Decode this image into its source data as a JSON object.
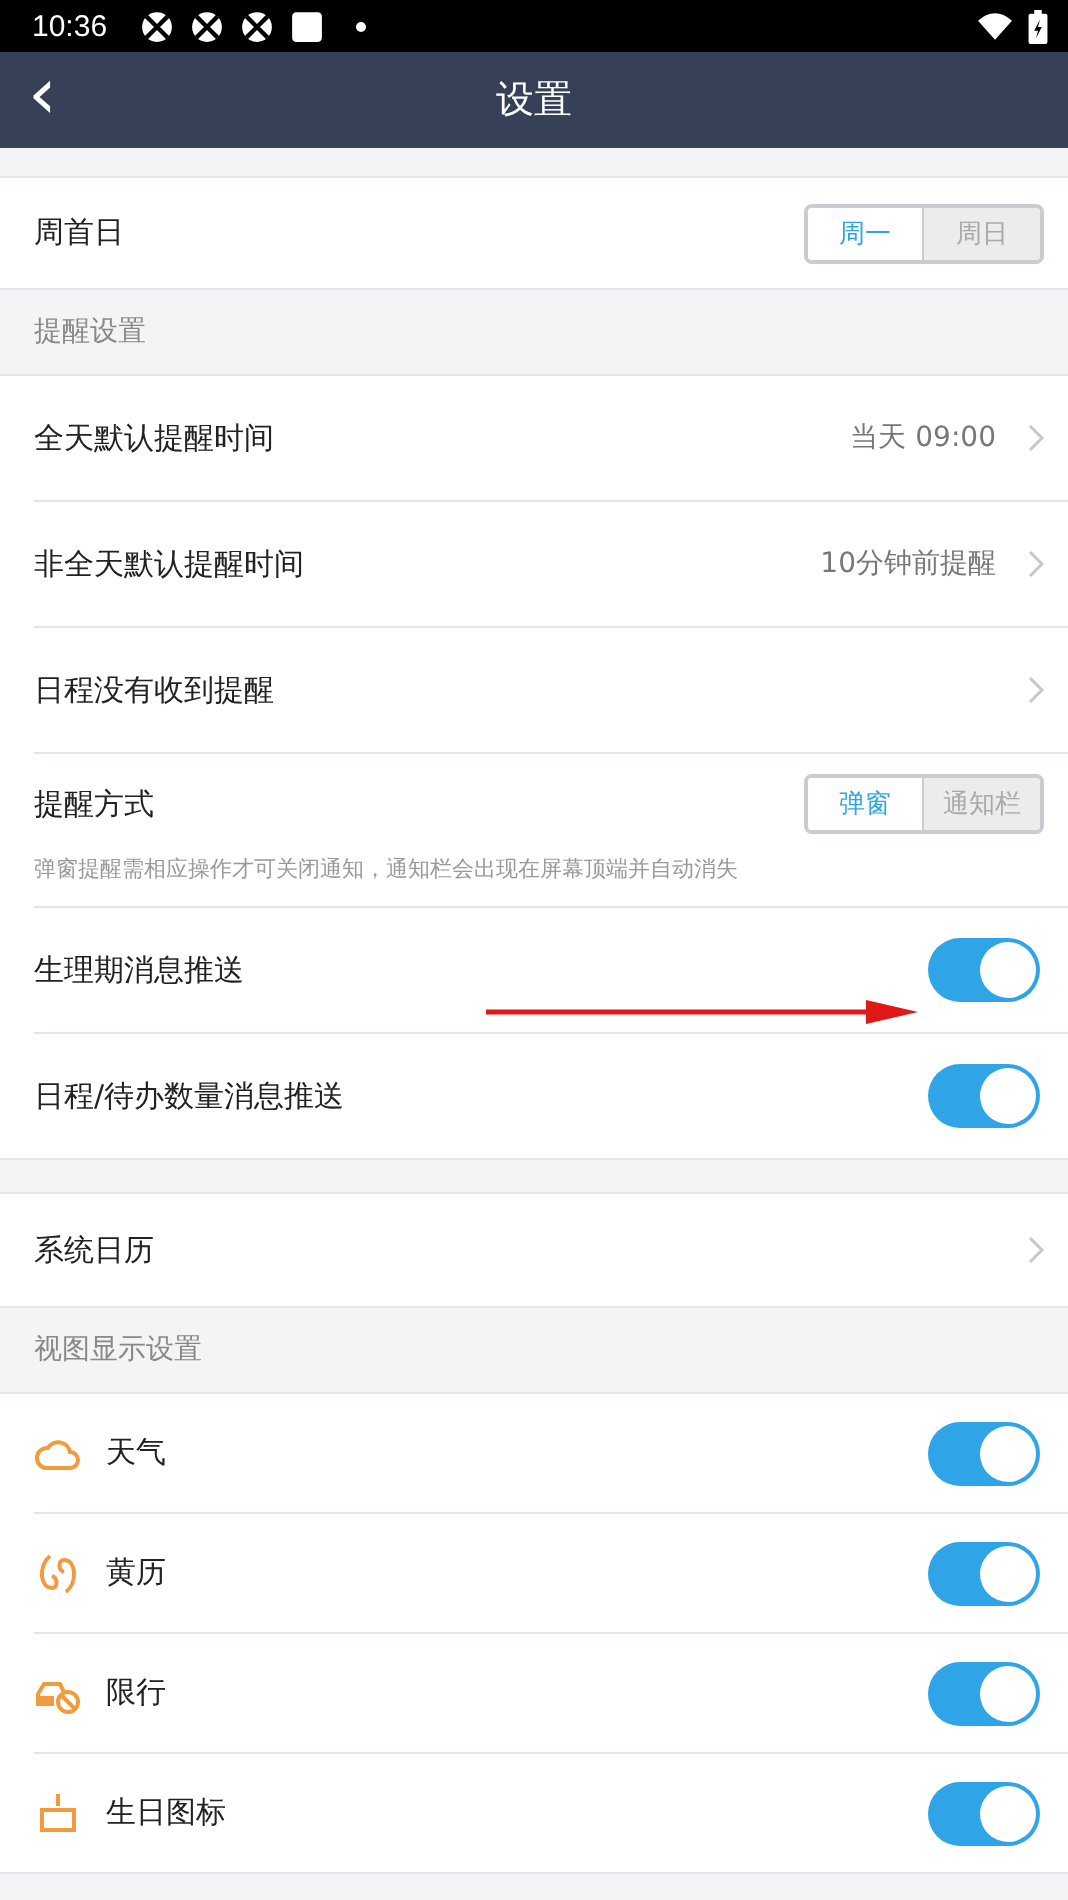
{
  "status_bar": {
    "time": "10:36"
  },
  "header": {
    "title": "设置",
    "back": "‹"
  },
  "groups": [
    {
      "rows": [
        {
          "kind": "segmented",
          "label": "周首日",
          "options": [
            {
              "label": "周一",
              "selected": true
            },
            {
              "label": "周日",
              "selected": false
            }
          ]
        }
      ]
    },
    {
      "title": "提醒设置",
      "rows": [
        {
          "kind": "link",
          "label": "全天默认提醒时间",
          "value": "当天 09:00"
        },
        {
          "kind": "link",
          "label": "非全天默认提醒时间",
          "value": "10分钟前提醒"
        },
        {
          "kind": "link",
          "label": "日程没有收到提醒"
        },
        {
          "kind": "segmented",
          "label": "提醒方式",
          "options": [
            {
              "label": "弹窗",
              "selected": true
            },
            {
              "label": "通知栏",
              "selected": false
            }
          ],
          "hint": "弹窗提醒需相应操作才可关闭通知，通知栏会出现在屏幕顶端并自动消失"
        },
        {
          "kind": "toggle",
          "label": "生理期消息推送",
          "on": true
        },
        {
          "kind": "toggle",
          "label": "日程/待办数量消息推送",
          "on": true
        }
      ]
    },
    {
      "rows": [
        {
          "kind": "link",
          "label": "系统日历"
        }
      ]
    },
    {
      "title": "视图显示设置",
      "rows": [
        {
          "kind": "icon-toggle",
          "label": "天气",
          "on": true
        },
        {
          "kind": "icon-toggle",
          "label": "黄历",
          "on": true
        },
        {
          "kind": "icon-toggle",
          "label": "限行",
          "on": true
        },
        {
          "kind": "icon-toggle",
          "label": "生日图标",
          "on": true
        }
      ]
    }
  ]
}
